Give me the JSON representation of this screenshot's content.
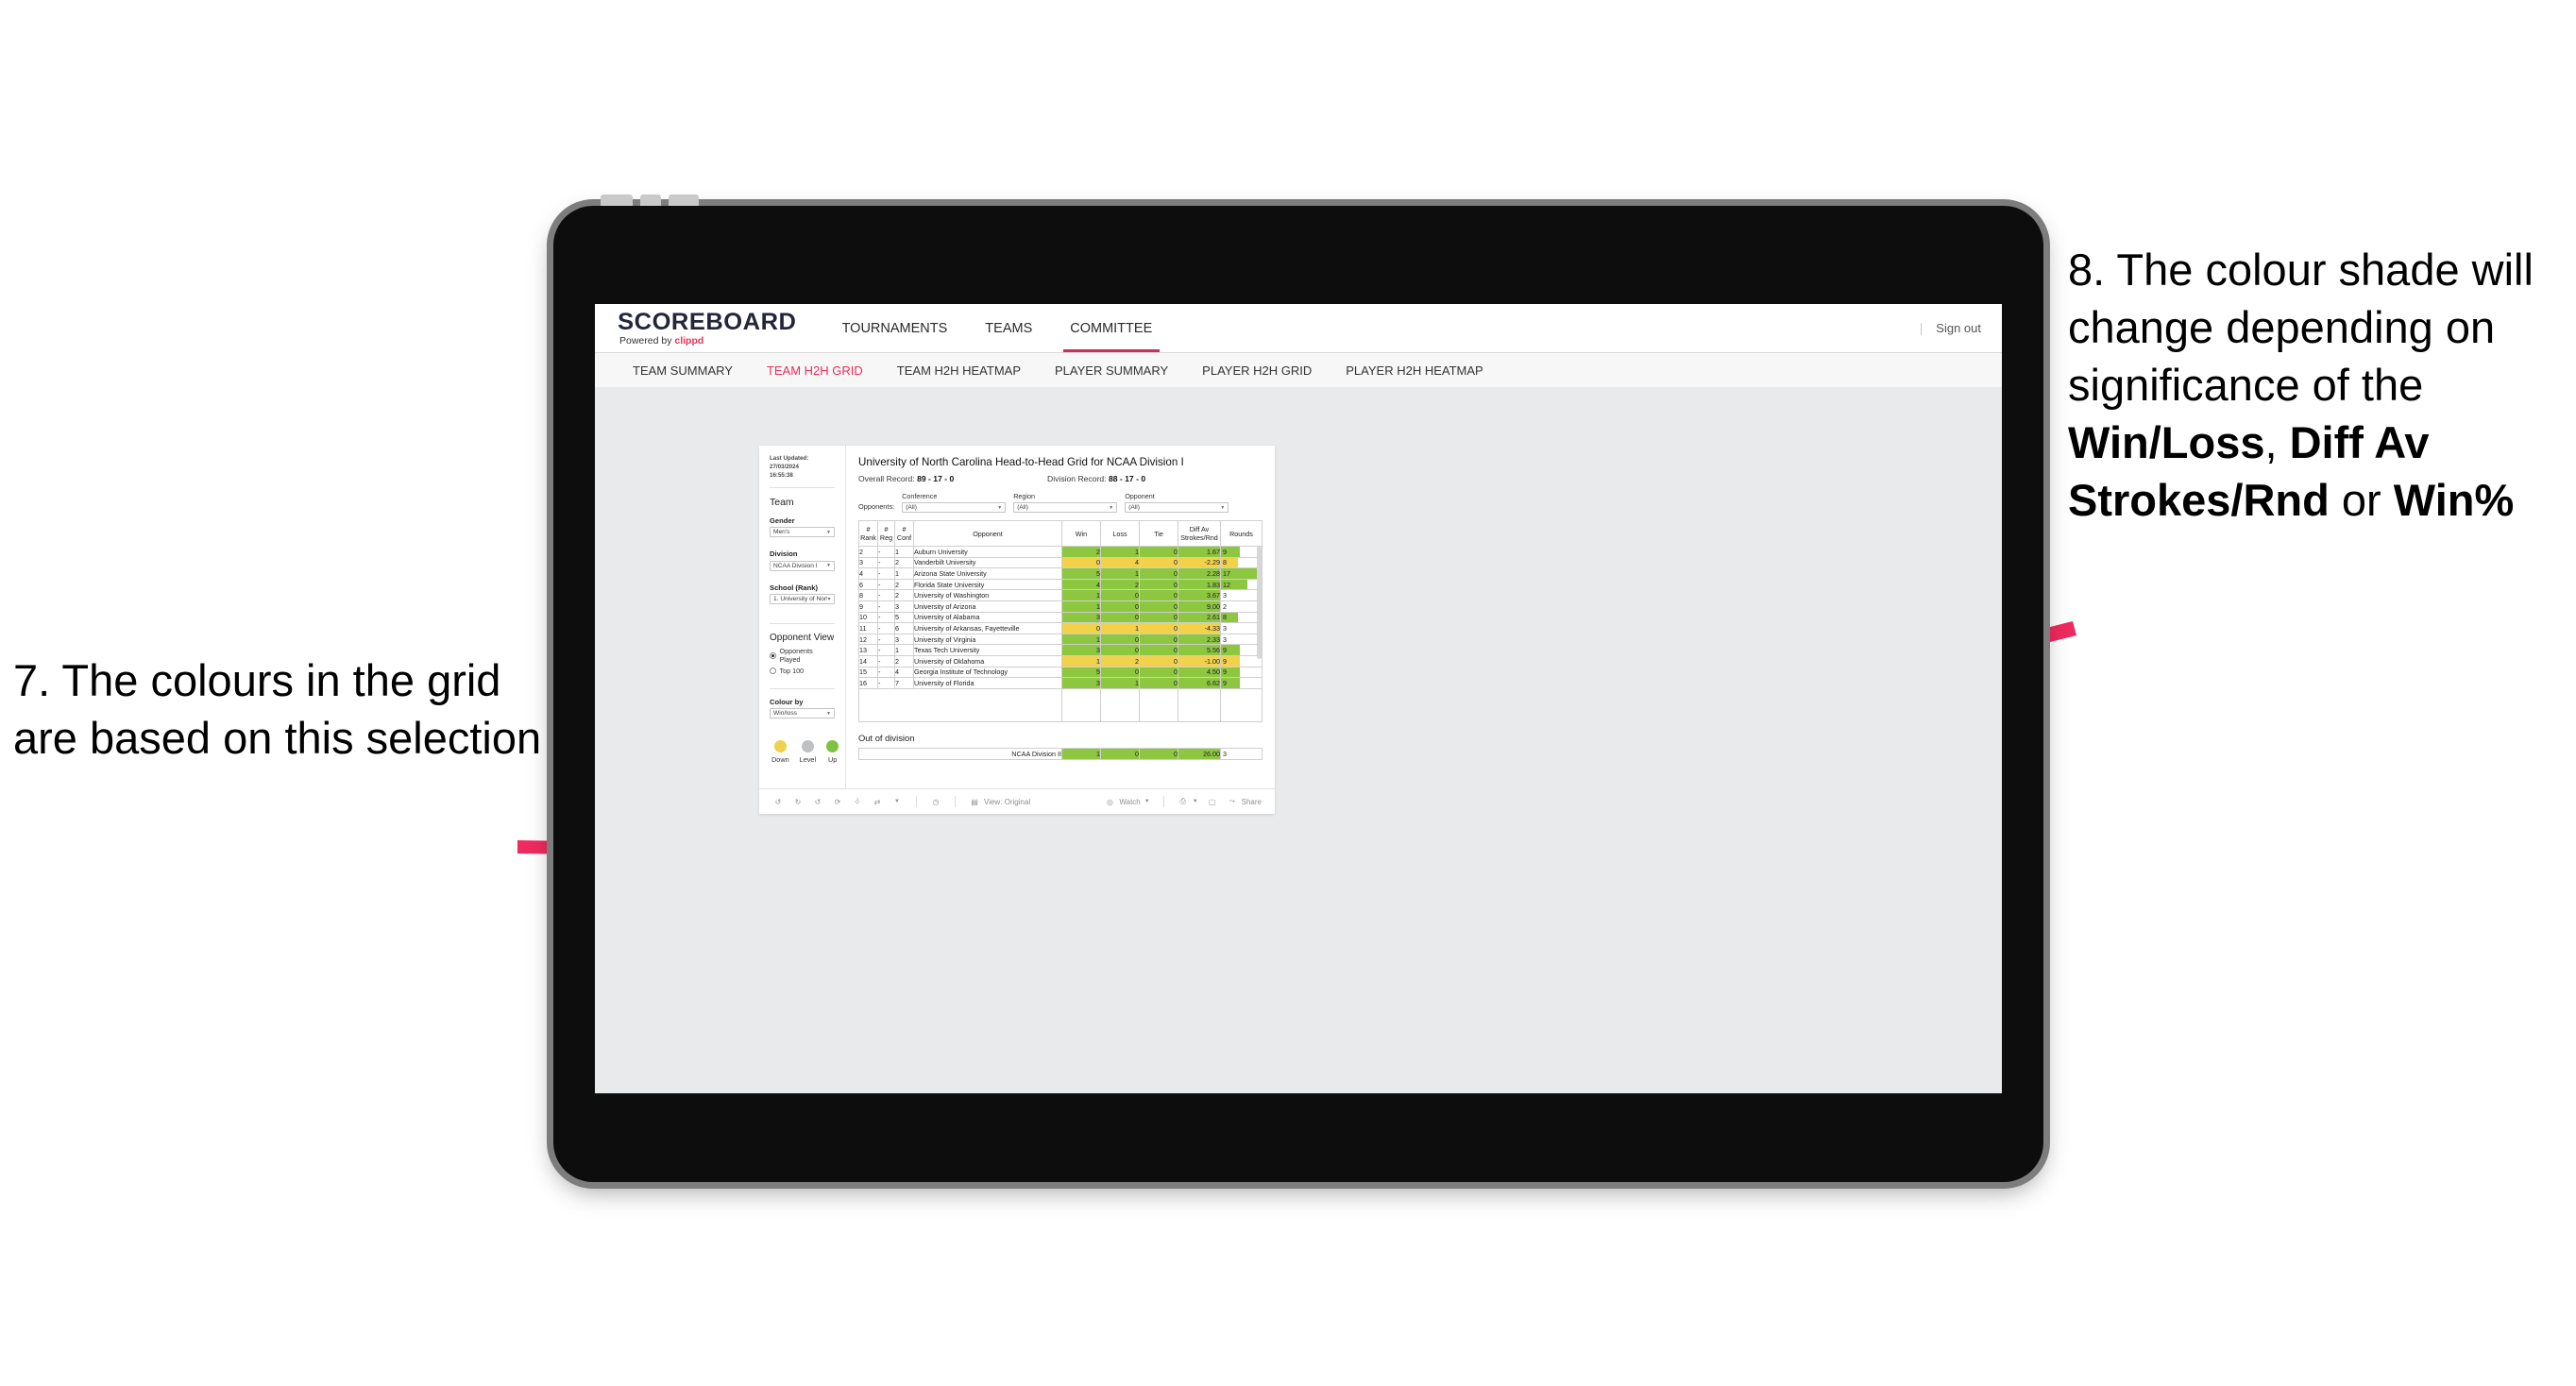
{
  "annotations": {
    "left": {
      "number": "7.",
      "text": "The colours in the grid are based on this selection"
    },
    "right": {
      "number": "8.",
      "line1": "The colour shade will change depending on significance of the ",
      "bold1": "Win/Loss",
      "mid1": ", ",
      "bold2": "Diff Av Strokes/Rnd",
      "mid2": " or ",
      "bold3": "Win%"
    },
    "arrow_color": "#EF2A5E"
  },
  "app": {
    "brand_main": "SCOREBOARD",
    "brand_sub_pre": "Powered by ",
    "brand_sub_accent": "clippd",
    "top_nav": [
      {
        "label": "TOURNAMENTS",
        "active": false
      },
      {
        "label": "TEAMS",
        "active": false
      },
      {
        "label": "COMMITTEE",
        "active": true
      }
    ],
    "sign_out": "Sign out",
    "sub_nav": [
      {
        "label": "TEAM SUMMARY",
        "active": false
      },
      {
        "label": "TEAM H2H GRID",
        "active": true
      },
      {
        "label": "TEAM H2H HEATMAP",
        "active": false
      },
      {
        "label": "PLAYER SUMMARY",
        "active": false
      },
      {
        "label": "PLAYER H2H GRID",
        "active": false
      },
      {
        "label": "PLAYER H2H HEATMAP",
        "active": false
      }
    ],
    "accent_color": "#E8305A"
  },
  "filter_pane": {
    "last_updated_line1": "Last Updated: 27/03/2024",
    "last_updated_line2": "16:55:38",
    "team_heading": "Team",
    "gender_label": "Gender",
    "gender_value": "Men's",
    "division_label": "Division",
    "division_value": "NCAA Division I",
    "school_label": "School (Rank)",
    "school_value": "1. University of Nort...",
    "opponent_view_heading": "Opponent View",
    "opponent_view_options": [
      {
        "label": "Opponents Played",
        "selected": true
      },
      {
        "label": "Top 100",
        "selected": false
      }
    ],
    "colour_by_label": "Colour by",
    "colour_by_value": "Win/loss",
    "legend": [
      {
        "label": "Down",
        "color": "#EDD14F"
      },
      {
        "label": "Level",
        "color": "#BFC0C2"
      },
      {
        "label": "Up",
        "color": "#7DC242"
      }
    ]
  },
  "content": {
    "title": "University of North Carolina Head-to-Head Grid for NCAA Division I",
    "overall_record_label": "Overall Record: ",
    "overall_record_value": "89 - 17 - 0",
    "division_record_label": "Division Record: ",
    "division_record_value": "88 - 17 - 0",
    "opponents_label": "Opponents:",
    "opponent_filters": [
      {
        "label": "Conference",
        "value": "(All)"
      },
      {
        "label": "Region",
        "value": "(All)"
      },
      {
        "label": "Opponent",
        "value": "(All)"
      }
    ],
    "out_of_division_title": "Out of division"
  },
  "chart_data": {
    "type": "table",
    "title": "University of North Carolina Head-to-Head Grid for NCAA Division I",
    "columns": [
      {
        "key": "rank",
        "header_line1": "#",
        "header_line2": "Rank"
      },
      {
        "key": "reg",
        "header_line1": "#",
        "header_line2": "Reg"
      },
      {
        "key": "conf",
        "header_line1": "#",
        "header_line2": "Conf"
      },
      {
        "key": "opponent",
        "header_line1": "Opponent",
        "header_line2": ""
      },
      {
        "key": "win",
        "header_line1": "Win",
        "header_line2": ""
      },
      {
        "key": "loss",
        "header_line1": "Loss",
        "header_line2": ""
      },
      {
        "key": "tie",
        "header_line1": "Tie",
        "header_line2": ""
      },
      {
        "key": "diff",
        "header_line1": "Diff Av",
        "header_line2": "Strokes/Rnd"
      },
      {
        "key": "rounds",
        "header_line1": "Rounds",
        "header_line2": ""
      }
    ],
    "colour_by": "Win/loss",
    "colors": {
      "up": "#8DC63F",
      "down": "#F2D14B",
      "level": "#BFC0C2"
    },
    "rows": [
      {
        "rank": "2",
        "reg": "-",
        "conf": "1",
        "opponent": "Auburn University",
        "win": "2",
        "loss": "1",
        "tie": "0",
        "diff": "1.67",
        "rounds": "9",
        "state": "up",
        "rounds_pct": 47
      },
      {
        "rank": "3",
        "reg": "-",
        "conf": "2",
        "opponent": "Vanderbilt University",
        "win": "0",
        "loss": "4",
        "tie": "0",
        "diff": "-2.29",
        "rounds": "8",
        "state": "down",
        "rounds_pct": 42
      },
      {
        "rank": "4",
        "reg": "-",
        "conf": "1",
        "opponent": "Arizona State University",
        "win": "5",
        "loss": "1",
        "tie": "0",
        "diff": "2.28",
        "rounds": "17",
        "state": "up",
        "rounds_pct": 90
      },
      {
        "rank": "6",
        "reg": "-",
        "conf": "2",
        "opponent": "Florida State University",
        "win": "4",
        "loss": "2",
        "tie": "0",
        "diff": "1.83",
        "rounds": "12",
        "state": "up",
        "rounds_pct": 64
      },
      {
        "rank": "8",
        "reg": "-",
        "conf": "2",
        "opponent": "University of Washington",
        "win": "1",
        "loss": "0",
        "tie": "0",
        "diff": "3.67",
        "rounds": "3",
        "state": "up",
        "rounds_pct": 0
      },
      {
        "rank": "9",
        "reg": "-",
        "conf": "3",
        "opponent": "University of Arizona",
        "win": "1",
        "loss": "0",
        "tie": "0",
        "diff": "9.00",
        "rounds": "2",
        "state": "up",
        "rounds_pct": 0
      },
      {
        "rank": "10",
        "reg": "-",
        "conf": "5",
        "opponent": "University of Alabama",
        "win": "3",
        "loss": "0",
        "tie": "0",
        "diff": "2.61",
        "rounds": "8",
        "state": "up",
        "rounds_pct": 42
      },
      {
        "rank": "11",
        "reg": "-",
        "conf": "6",
        "opponent": "University of Arkansas, Fayetteville",
        "win": "0",
        "loss": "1",
        "tie": "0",
        "diff": "-4.33",
        "rounds": "3",
        "state": "down",
        "rounds_pct": 0
      },
      {
        "rank": "12",
        "reg": "-",
        "conf": "3",
        "opponent": "University of Virginia",
        "win": "1",
        "loss": "0",
        "tie": "0",
        "diff": "2.33",
        "rounds": "3",
        "state": "up",
        "rounds_pct": 0
      },
      {
        "rank": "13",
        "reg": "-",
        "conf": "1",
        "opponent": "Texas Tech University",
        "win": "3",
        "loss": "0",
        "tie": "0",
        "diff": "5.56",
        "rounds": "9",
        "state": "up",
        "rounds_pct": 47
      },
      {
        "rank": "14",
        "reg": "-",
        "conf": "2",
        "opponent": "University of Oklahoma",
        "win": "1",
        "loss": "2",
        "tie": "0",
        "diff": "-1.00",
        "rounds": "9",
        "state": "down",
        "rounds_pct": 47
      },
      {
        "rank": "15",
        "reg": "-",
        "conf": "4",
        "opponent": "Georgia Institute of Technology",
        "win": "5",
        "loss": "0",
        "tie": "0",
        "diff": "4.50",
        "rounds": "9",
        "state": "up",
        "rounds_pct": 47
      },
      {
        "rank": "16",
        "reg": "-",
        "conf": "7",
        "opponent": "University of Florida",
        "win": "3",
        "loss": "1",
        "tie": "0",
        "diff": "6.62",
        "rounds": "9",
        "state": "up",
        "rounds_pct": 47
      }
    ],
    "out_of_division": [
      {
        "opponent": "NCAA Division II",
        "win": "1",
        "loss": "0",
        "tie": "0",
        "diff": "26.00",
        "rounds": "3",
        "state": "up",
        "rounds_pct": 0
      }
    ]
  },
  "viz_toolbar": {
    "view_label": "View: Original",
    "watch_label": "Watch",
    "share_label": "Share",
    "icons": [
      "undo-icon",
      "redo-icon",
      "revert-icon",
      "refresh-icon",
      "pause-icon",
      "swap-icon",
      "caret-down-icon",
      "clock-icon",
      "view-icon",
      "watch-icon",
      "download-icon",
      "device-icon",
      "share-icon"
    ]
  }
}
